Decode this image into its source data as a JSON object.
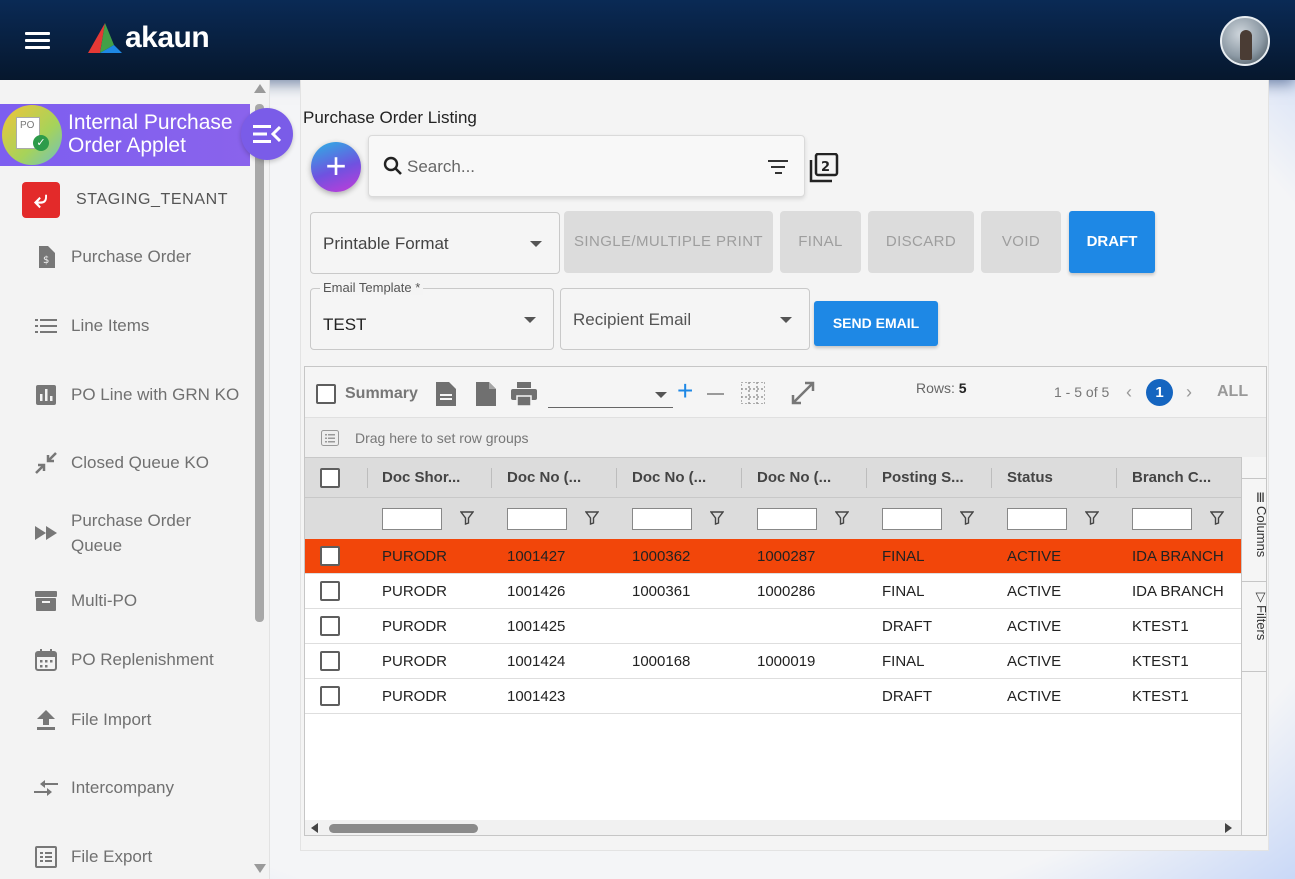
{
  "app": {
    "logo_text": "akaun",
    "brand_color": "#0a2a55",
    "accent_color": "#7d5ef0"
  },
  "sidebar": {
    "applet_title_line1": "Internal Purchase",
    "applet_title_line2": "Order Applet",
    "applet_icon_text": "PO",
    "tenant": "STAGING_TENANT",
    "items": [
      {
        "label": "Purchase Order",
        "icon": "dollar-doc-icon"
      },
      {
        "label": "Line Items",
        "icon": "list-icon"
      },
      {
        "label": "PO Line with GRN KO",
        "icon": "bar-chart-icon"
      },
      {
        "label": "Closed Queue KO",
        "icon": "collapse-arrows-icon"
      },
      {
        "label": "Purchase Order",
        "label2": "Queue",
        "icon": "fast-forward-icon"
      },
      {
        "label": "Multi-PO",
        "icon": "archive-box-icon"
      },
      {
        "label": "PO Replenishment",
        "icon": "calendar-icon"
      },
      {
        "label": "File Import",
        "icon": "upload-icon"
      },
      {
        "label": "Intercompany",
        "icon": "swap-arrows-icon"
      },
      {
        "label": "File Export",
        "icon": "document-list-icon"
      }
    ]
  },
  "main": {
    "title": "Purchase Order Listing",
    "search_placeholder": "Search...",
    "printable_format": "Printable Format",
    "buttons": {
      "single_multiple_print": "SINGLE/MULTIPLE PRINT",
      "final": "FINAL",
      "discard": "DISCARD",
      "void": "VOID",
      "draft": "DRAFT",
      "send_email": "SEND EMAIL"
    },
    "email_template_label": "Email Template *",
    "email_template_value": "TEST",
    "recipient_email": "Recipient Email"
  },
  "grid": {
    "summary_label": "Summary",
    "rows_label": "Rows:",
    "rows_value": "5",
    "pagination_text": "1 - 5 of 5",
    "current_page": "1",
    "all_label": "ALL",
    "group_hint": "Drag here to set row groups",
    "columns": [
      "Doc Shor...",
      "Doc No (...",
      "Doc No (...",
      "Doc No (...",
      "Posting S...",
      "Status",
      "Branch C..."
    ],
    "rows": [
      [
        "PURODR",
        "1001427",
        "1000362",
        "1000287",
        "FINAL",
        "ACTIVE",
        "IDA BRANCH"
      ],
      [
        "PURODR",
        "1001426",
        "1000361",
        "1000286",
        "FINAL",
        "ACTIVE",
        "IDA BRANCH"
      ],
      [
        "PURODR",
        "1001425",
        "",
        "",
        "DRAFT",
        "ACTIVE",
        "KTEST1"
      ],
      [
        "PURODR",
        "1001424",
        "1000168",
        "1000019",
        "FINAL",
        "ACTIVE",
        "KTEST1"
      ],
      [
        "PURODR",
        "1001423",
        "",
        "",
        "DRAFT",
        "ACTIVE",
        "KTEST1"
      ]
    ],
    "side_tabs": {
      "columns": "Columns",
      "filters": "Filters"
    },
    "selected_row_color": "#f2460a"
  }
}
